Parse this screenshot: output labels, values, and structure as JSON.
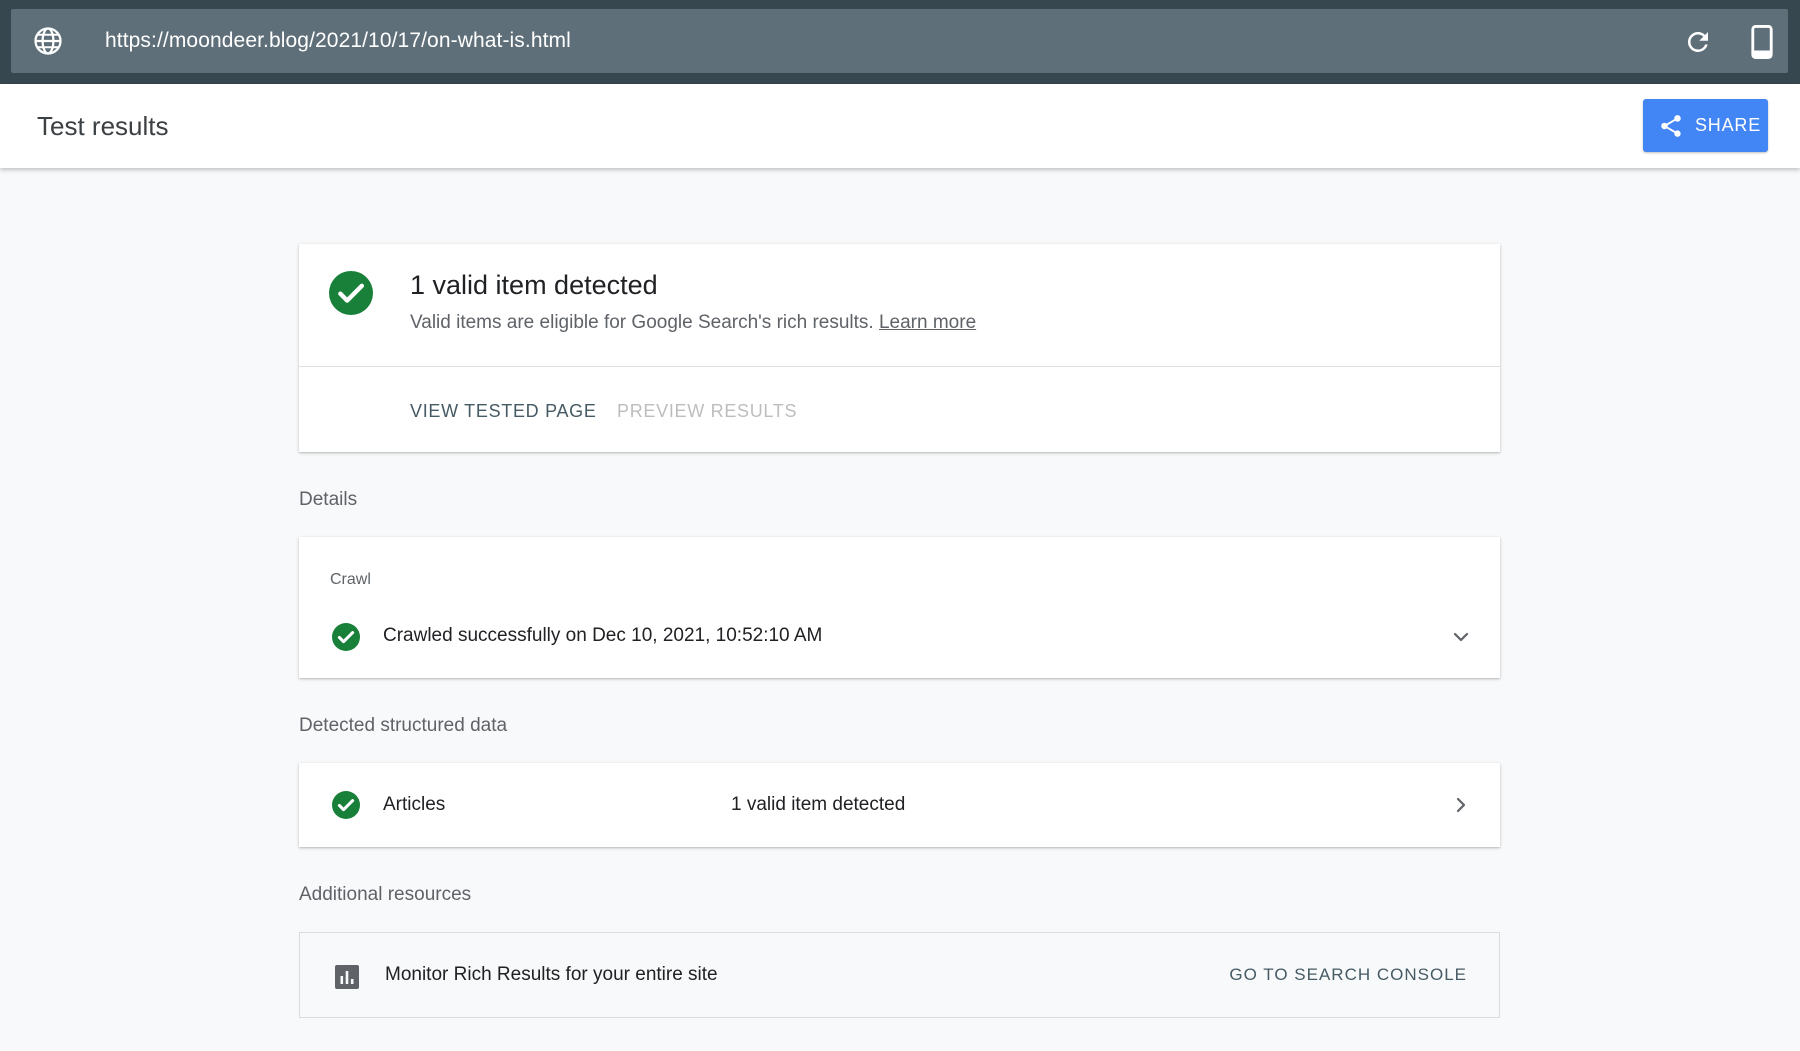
{
  "address_bar": {
    "url": "https://moondeer.blog/2021/10/17/on-what-is.html"
  },
  "header": {
    "title": "Test results",
    "share_label": "SHARE"
  },
  "summary": {
    "heading": "1 valid item detected",
    "description": "Valid items are eligible for Google Search's rich results.",
    "learn_more": "Learn more",
    "view_tested_page": "VIEW TESTED PAGE",
    "preview_results": "PREVIEW RESULTS"
  },
  "details": {
    "section_label": "Details",
    "crawl_label": "Crawl",
    "crawl_status": "Crawled successfully on Dec 10, 2021, 10:52:10 AM"
  },
  "structured_data": {
    "section_label": "Detected structured data",
    "items": [
      {
        "type": "Articles",
        "status": "1 valid item detected"
      }
    ]
  },
  "additional_resources": {
    "section_label": "Additional resources",
    "monitor_text": "Monitor Rich Results for your entire site",
    "console_link": "GO TO SEARCH CONSOLE"
  },
  "colors": {
    "topbar": "#37474f",
    "urlbar": "#5f6f79",
    "share_button": "#4285f4",
    "success_green": "#188038"
  },
  "icons": [
    "globe-icon",
    "refresh-icon",
    "mobile-device-icon",
    "share-icon",
    "check-circle-icon",
    "chevron-down-icon",
    "chevron-right-icon",
    "bar-chart-icon"
  ]
}
